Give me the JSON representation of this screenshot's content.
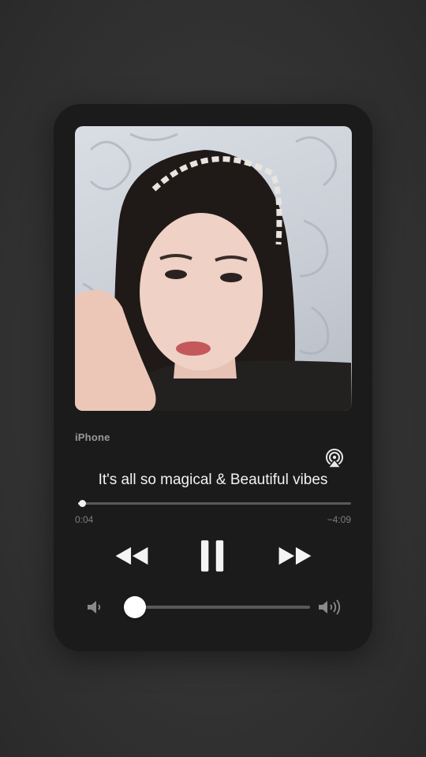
{
  "player": {
    "device_label": "iPhone",
    "song_title": "It's all so magical & Beautiful vibes",
    "elapsed": "0:04",
    "remaining": "−4:09",
    "progress_fraction": 0.015,
    "volume_fraction": 0.0,
    "state": "playing",
    "artwork_description_icon": "album-artwork",
    "icons": {
      "airplay": "airplay-icon",
      "rewind": "rewind-icon",
      "pause": "pause-icon",
      "forward": "fast-forward-icon",
      "volume_low": "speaker-low-icon",
      "volume_high": "speaker-high-icon"
    },
    "colors": {
      "card": "#1b1b1b",
      "text": "#f2f2f2",
      "secondary": "#9a9a9a"
    }
  }
}
